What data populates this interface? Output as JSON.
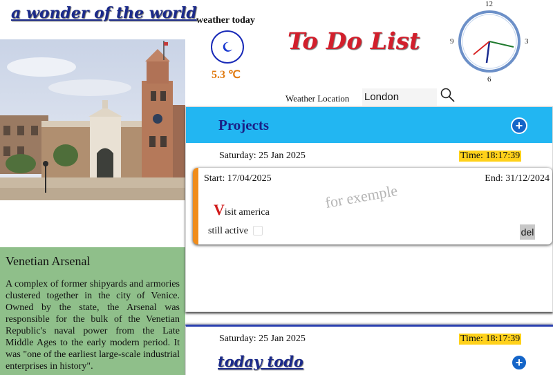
{
  "wonder": {
    "title": "a wonder of the world",
    "photo_subject": "Venetian Arsenal",
    "info_title": "Venetian Arsenal",
    "info_text": "A complex of former shipyards and armories clustered together in the city of Venice. Owned by the state, the Arsenal was responsible for the bulk of the Venetian Republic's naval power from the Late Middle Ages to the early modern period. It was \"one of the earliest large-scale industrial enterprises in history\"."
  },
  "weather": {
    "heading": "weather today",
    "icon": "moon-icon",
    "temperature": "5.3 ℃",
    "location_label": "Weather Location",
    "location_value": "London"
  },
  "app": {
    "title": "To Do List"
  },
  "clock": {
    "numbers": [
      "12",
      "3",
      "6",
      "9"
    ]
  },
  "projects": {
    "title": "Projects",
    "add_label": "+",
    "date": "Saturday: 25 Jan 2025",
    "time": "Time: 18:17:39",
    "tasks": [
      {
        "start": "Start: 17/04/2025",
        "end": "End: 31/12/2024",
        "first_letter": "V",
        "name_rest": "isit america",
        "watermark": "for exemple",
        "status_label": "still active",
        "delete_label": "del"
      }
    ]
  },
  "today": {
    "date": "Saturday: 25 Jan 2025",
    "time": "Time: 18:17:39",
    "title": "today todo",
    "add_label": "+"
  },
  "colors": {
    "accent_blue": "#22b6f2",
    "title_red": "#d21f2c",
    "info_green": "#8fbf8a",
    "time_highlight": "#ffd11a",
    "card_border": "#f08c1a"
  }
}
